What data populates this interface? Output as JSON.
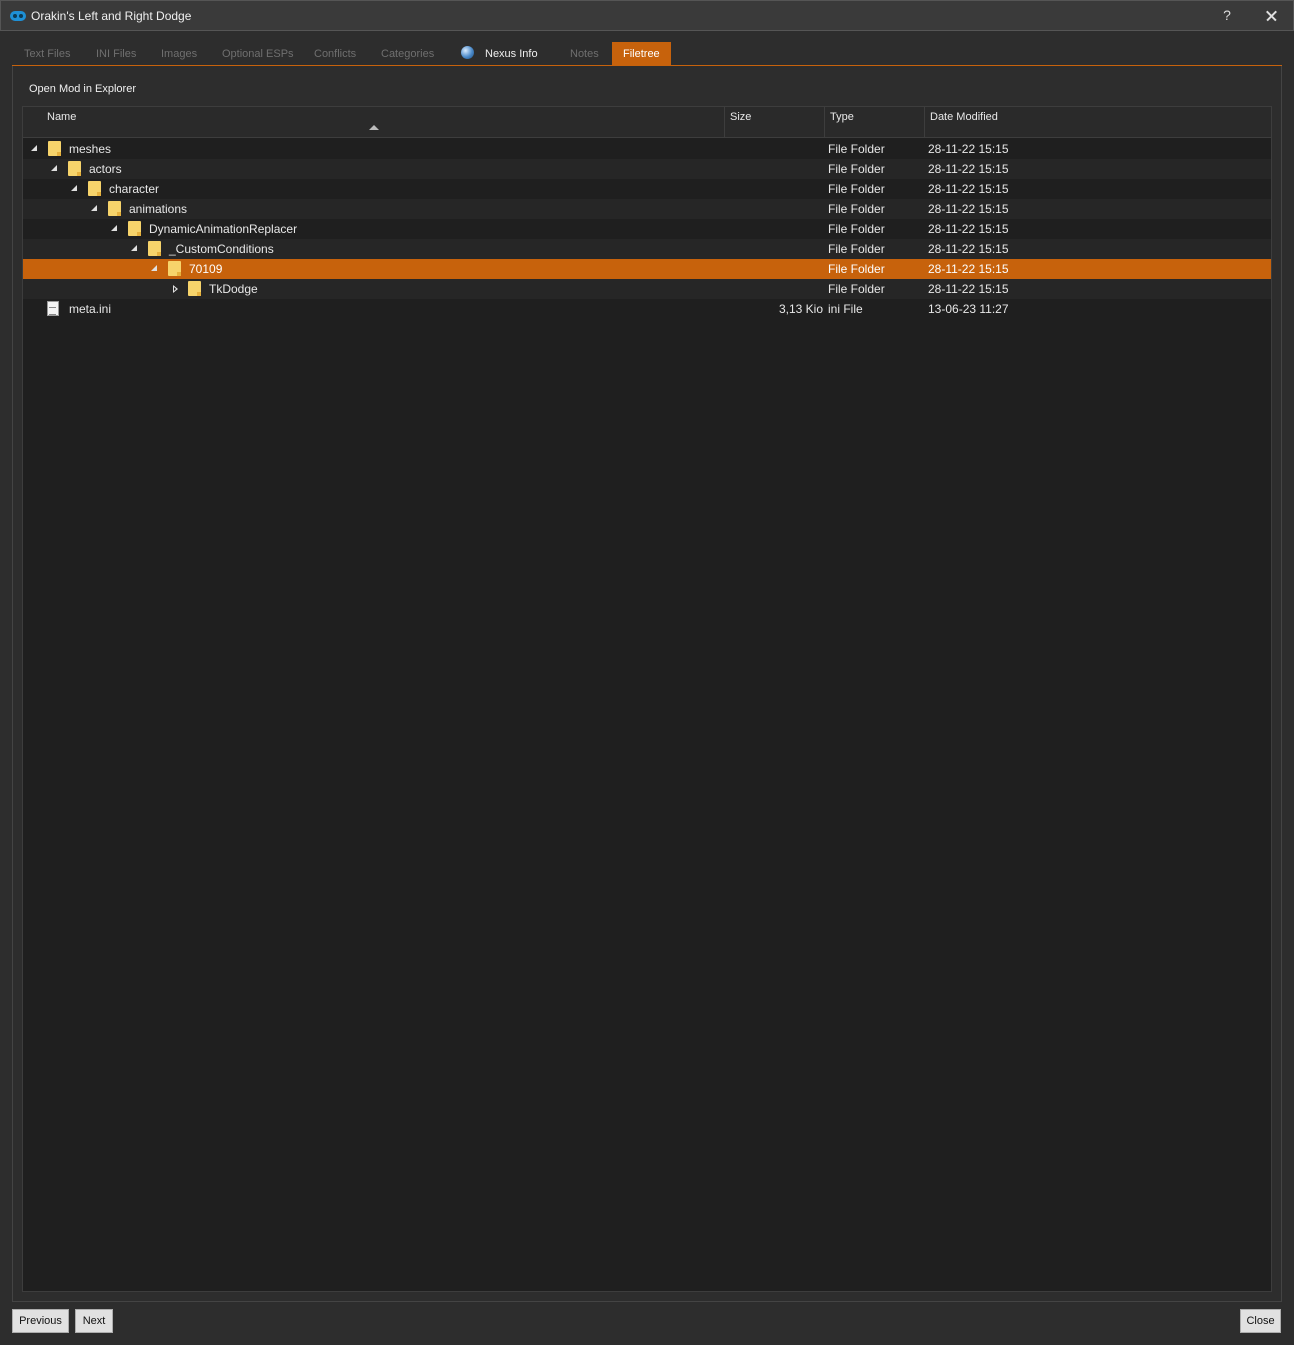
{
  "window": {
    "title": "Orakin's Left and Right Dodge",
    "help_label": "?"
  },
  "tabs": [
    {
      "label": "Text Files"
    },
    {
      "label": "INI Files"
    },
    {
      "label": "Images"
    },
    {
      "label": "Optional ESPs"
    },
    {
      "label": "Conflicts"
    },
    {
      "label": "Categories"
    },
    {
      "label": "Nexus Info",
      "icon": "globe-icon"
    },
    {
      "label": "Notes"
    },
    {
      "label": "Filetree",
      "active": true
    }
  ],
  "filetree": {
    "open_explorer_label": "Open Mod in Explorer",
    "columns": {
      "name": "Name",
      "size": "Size",
      "type": "Type",
      "date": "Date Modified"
    },
    "rows": [
      {
        "name": "meshes",
        "size": "",
        "type": "File Folder",
        "date": "28-11-22 15:15",
        "depth": 0,
        "kind": "folder",
        "expanded": true
      },
      {
        "name": "actors",
        "size": "",
        "type": "File Folder",
        "date": "28-11-22 15:15",
        "depth": 1,
        "kind": "folder",
        "expanded": true
      },
      {
        "name": "character",
        "size": "",
        "type": "File Folder",
        "date": "28-11-22 15:15",
        "depth": 2,
        "kind": "folder",
        "expanded": true
      },
      {
        "name": "animations",
        "size": "",
        "type": "File Folder",
        "date": "28-11-22 15:15",
        "depth": 3,
        "kind": "folder",
        "expanded": true
      },
      {
        "name": "DynamicAnimationReplacer",
        "size": "",
        "type": "File Folder",
        "date": "28-11-22 15:15",
        "depth": 4,
        "kind": "folder",
        "expanded": true
      },
      {
        "name": "_CustomConditions",
        "size": "",
        "type": "File Folder",
        "date": "28-11-22 15:15",
        "depth": 5,
        "kind": "folder",
        "expanded": true
      },
      {
        "name": "70109",
        "size": "",
        "type": "File Folder",
        "date": "28-11-22 15:15",
        "depth": 6,
        "kind": "folder",
        "expanded": true,
        "selected": true
      },
      {
        "name": "TkDodge",
        "size": "",
        "type": "File Folder",
        "date": "28-11-22 15:15",
        "depth": 7,
        "kind": "folder",
        "expanded": false
      },
      {
        "name": "meta.ini",
        "size": "3,13 Kio",
        "type": "ini File",
        "date": "13-06-23 11:27",
        "depth": 1,
        "kind": "file"
      }
    ]
  },
  "footer": {
    "previous_label": "Previous",
    "next_label": "Next",
    "close_label": "Close"
  },
  "colors": {
    "accent": "#c7620c",
    "background": "#2d2d2d",
    "tree_background": "#1f1f1f"
  }
}
